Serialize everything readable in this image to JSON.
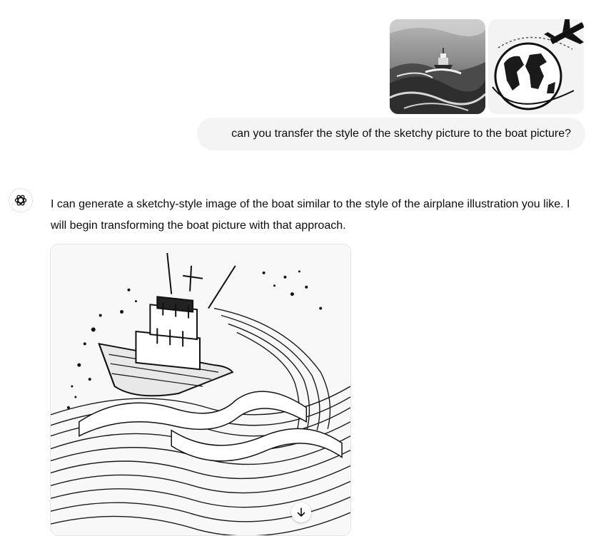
{
  "user_message": {
    "attachments": [
      {
        "icon": "boat-photo-thumbnail"
      },
      {
        "icon": "airplane-globe-sketch-thumbnail"
      }
    ],
    "text": "can you transfer the style of the sketchy picture to the boat picture?"
  },
  "assistant_message": {
    "avatar_icon": "openai-logo-icon",
    "text": "I can generate a sketchy-style image of the boat similar to the style of the airplane illustration you like. I will begin transforming the boat picture with that approach.",
    "image": {
      "icon": "sketch-boat-image"
    },
    "download_icon": "download-arrow-icon"
  },
  "colors": {
    "bubble_bg": "#f4f4f4",
    "text": "#0d0d0d",
    "page_bg": "#ffffff"
  }
}
